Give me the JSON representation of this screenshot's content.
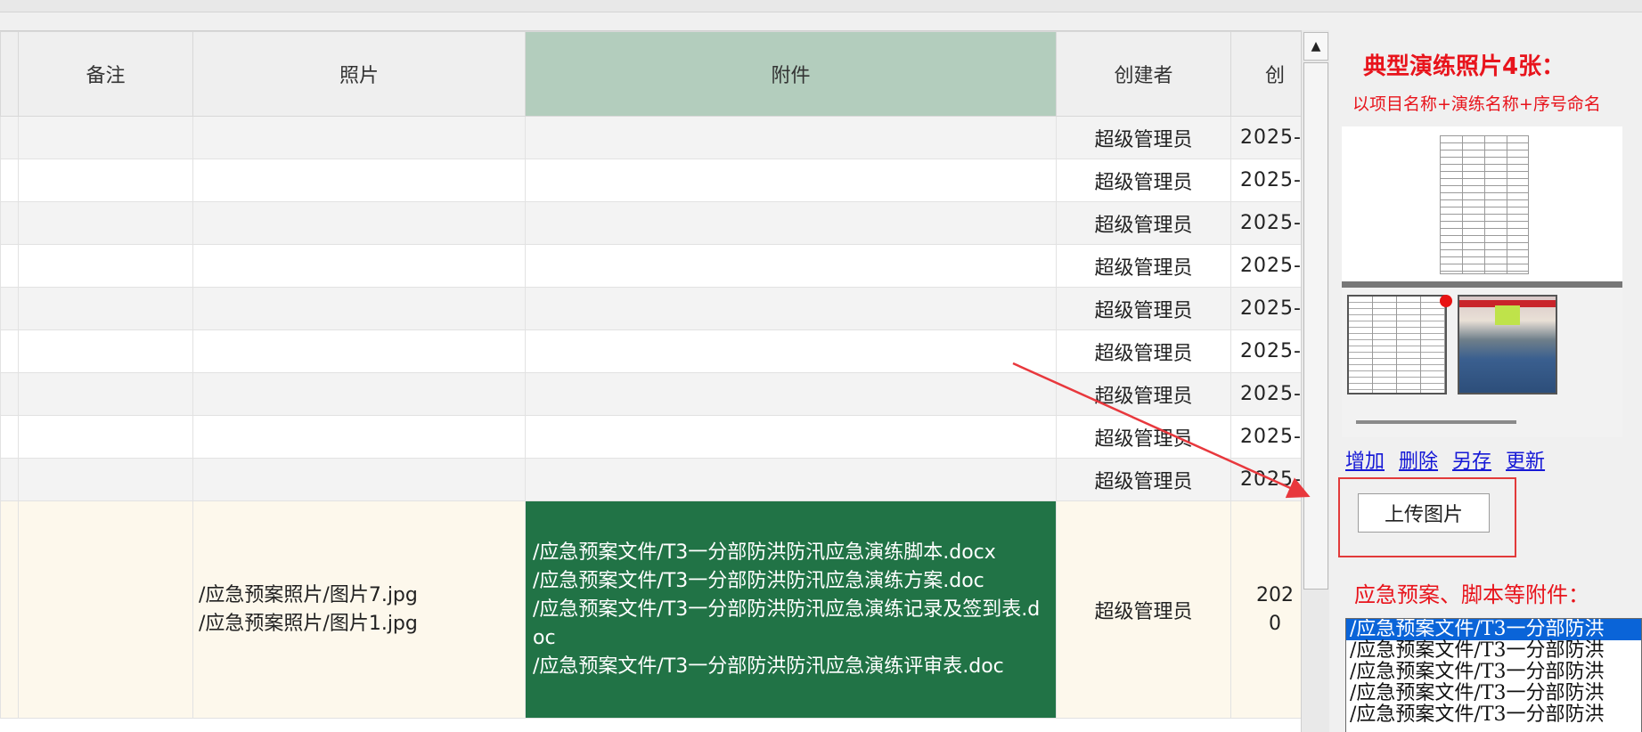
{
  "columns": {
    "note": "备注",
    "photo": "照片",
    "attachment": "附件",
    "creator": "创建者",
    "created": "创"
  },
  "rows": [
    {
      "creator": "超级管理员",
      "date": "2025-"
    },
    {
      "creator": "超级管理员",
      "date": "2025-"
    },
    {
      "creator": "超级管理员",
      "date": "2025-"
    },
    {
      "creator": "超级管理员",
      "date": "2025-"
    },
    {
      "creator": "超级管理员",
      "date": "2025-"
    },
    {
      "creator": "超级管理员",
      "date": "2025-"
    },
    {
      "creator": "超级管理员",
      "date": "2025-"
    },
    {
      "creator": "超级管理员",
      "date": "2025-"
    },
    {
      "creator": "超级管理员",
      "date": "2025-"
    }
  ],
  "selected_row": {
    "photos": [
      "/应急预案照片/图片7.jpg",
      "/应急预案照片/图片1.jpg"
    ],
    "attachments": [
      "/应急预案文件/T3一分部防洪防汛应急演练脚本.docx",
      "/应急预案文件/T3一分部防洪防汛应急演练方案.doc",
      "/应急预案文件/T3一分部防洪防汛应急演练记录及签到表.doc",
      "/应急预案文件/T3一分部防洪防汛应急演练评审表.doc"
    ],
    "creator": "超级管理员",
    "date_line1": "202",
    "date_line2": "0"
  },
  "scrollbar": {
    "up_arrow": "▲"
  },
  "panel": {
    "title": "典型演练照片4张：",
    "subtitle": "以项目名称+演练名称+序号命名",
    "actions": [
      "增加",
      "删除",
      "另存",
      "更新"
    ],
    "upload_label": "上传图片",
    "attach_title": "应急预案、脚本等附件：",
    "attach_list": [
      "/应急预案文件/T3一分部防洪",
      "/应急预案文件/T3一分部防洪",
      "/应急预案文件/T3一分部防洪",
      "/应急预案文件/T3一分部防洪",
      "/应急预案文件/T3一分部防洪"
    ]
  },
  "colors": {
    "attachment_header": "#b3cdbd",
    "attachment_cell": "#217346",
    "panel_red": "#e8141c",
    "link_blue": "#1518d6",
    "list_highlight": "#0a64d8"
  }
}
